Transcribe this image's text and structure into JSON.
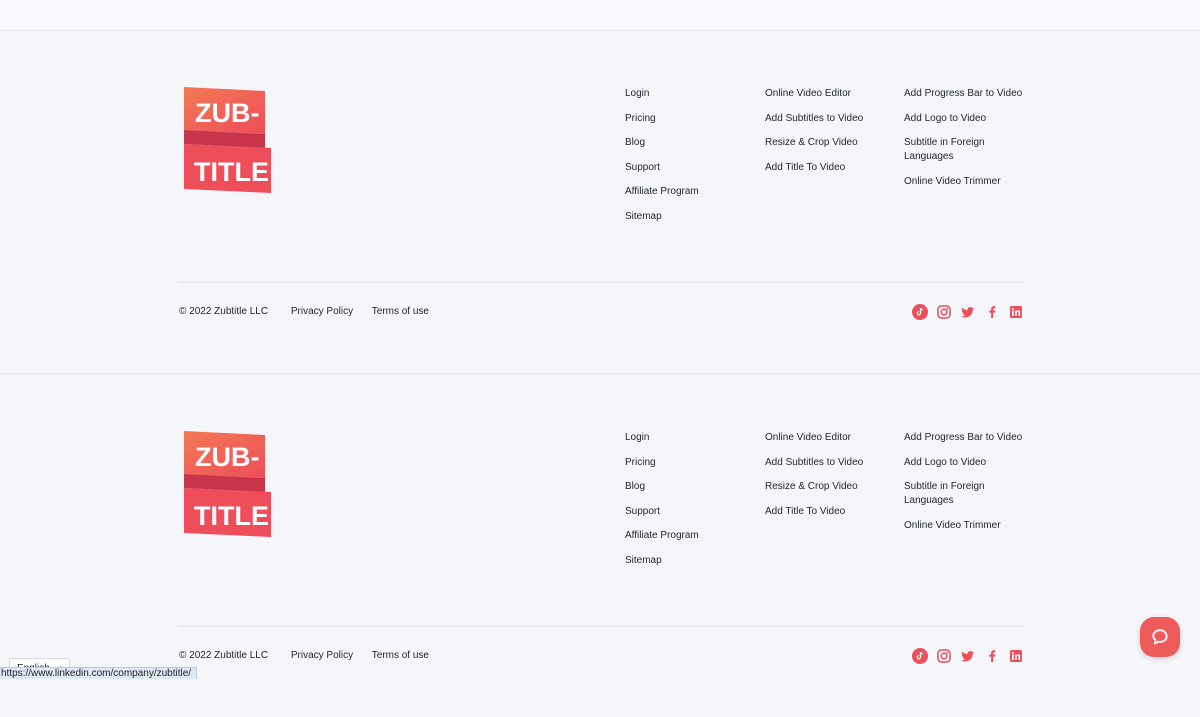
{
  "brand": {
    "logo_text_top": "ZUB-",
    "logo_text_bottom": "TITLE",
    "accent_color": "#ee4d5a"
  },
  "footer": {
    "col1": [
      "Login",
      "Pricing",
      "Blog",
      "Support",
      "Affiliate Program",
      "Sitemap"
    ],
    "col2": [
      "Online Video Editor",
      "Add Subtitles to Video",
      "Resize & Crop Video",
      "Add Title To Video"
    ],
    "col3": [
      "Add Progress Bar to Video",
      "Add Logo to Video",
      "Subtitle in Foreign Languages",
      "Online Video Trimmer"
    ],
    "copyright": "© 2022 Zubtitle LLC",
    "privacy": "Privacy Policy",
    "terms": "Terms of use",
    "socials": [
      "tiktok-icon",
      "instagram-icon",
      "twitter-icon",
      "facebook-icon",
      "linkedin-icon"
    ]
  },
  "language": {
    "label": "English",
    "chevron": "›"
  },
  "status_bar": {
    "url": "https://www.linkedin.com/company/zubtitle/"
  }
}
